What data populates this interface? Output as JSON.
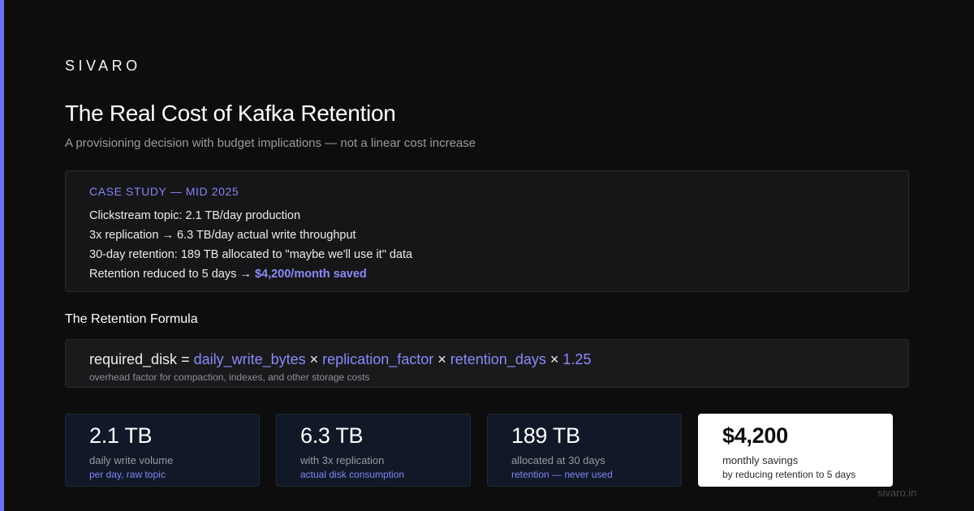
{
  "brand": "SIVARO",
  "title": "The Real Cost of Kafka Retention",
  "subtitle": "A provisioning decision with budget implications — not a linear cost increase",
  "case_study": {
    "label": "CASE STUDY — MID 2025",
    "lines": [
      "Clickstream topic: 2.1 TB/day production",
      "3x replication → 6.3 TB/day actual write throughput",
      "30-day retention: 189 TB allocated to \"maybe we'll use it\" data",
      "Retention reduced to 5 days → "
    ],
    "highlight": "$4,200/month saved"
  },
  "formula": {
    "heading": "The Retention Formula",
    "lhs": "required_disk = ",
    "term1": "daily_write_bytes",
    "op": " × ",
    "term2": "replication_factor",
    "term3": "retention_days",
    "factor": "1.25",
    "note": "overhead factor for compaction, indexes, and other storage costs"
  },
  "stats": [
    {
      "value": "2.1 TB",
      "label": "daily write volume",
      "sub": "per day, raw topic"
    },
    {
      "value": "6.3 TB",
      "label": "with 3x replication",
      "sub": "actual disk consumption"
    },
    {
      "value": "189 TB",
      "label": "allocated at 30 days",
      "sub": "retention — never used"
    },
    {
      "value": "$4,200",
      "label": "monthly savings",
      "sub": "by reducing retention to 5 days"
    }
  ],
  "footer_url": "sivaro.in",
  "colors": {
    "background": "#0d0d0e",
    "accent": "#6d6ff0",
    "highlight": "#8a8af8"
  }
}
